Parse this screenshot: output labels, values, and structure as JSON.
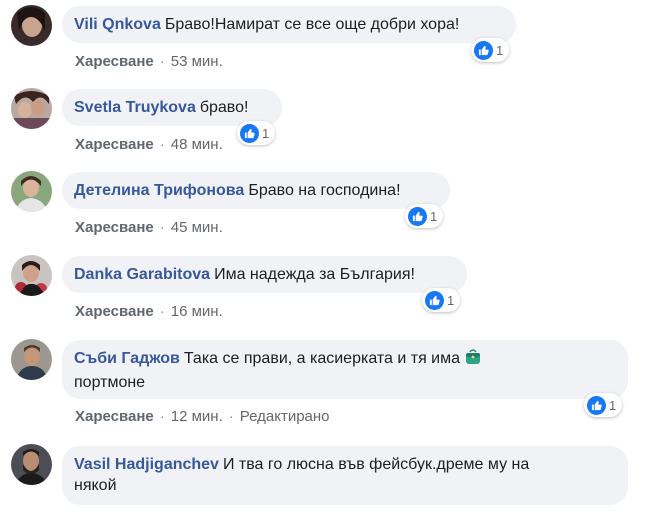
{
  "comments": [
    {
      "author": "Vili Qnkova",
      "text": "Браво!Намират се все още добри хора!",
      "like_label": "Харесване",
      "time": "53 мин.",
      "reactions": "1",
      "edited": ""
    },
    {
      "author": "Svetla Truykova",
      "text": "браво!",
      "like_label": "Харесване",
      "time": "48 мин.",
      "reactions": "1",
      "edited": ""
    },
    {
      "author": "Детелина Трифонова",
      "text": "Браво на господина!",
      "like_label": "Харесване",
      "time": "45 мин.",
      "reactions": "1",
      "edited": ""
    },
    {
      "author": "Danka Garabitova",
      "text": "Има надежда за България!",
      "like_label": "Харесване",
      "time": "16 мин.",
      "reactions": "1",
      "edited": ""
    },
    {
      "author": "Съби Гаджов",
      "text": "Така се прави, а касиерката и тя има",
      "text2": "портмоне",
      "like_label": "Харесване",
      "time": "12 мин.",
      "reactions": "1",
      "edited": "Редактирано"
    },
    {
      "author": "Vasil Hadjiganchev",
      "text": "И тва го люсна във фейсбук.дреме му на",
      "text2": "някой"
    }
  ],
  "icons": {
    "like": "thumbs-up-icon",
    "purse": "purse-emoji-icon"
  },
  "colors": {
    "author": "#385898",
    "bubble": "#f0f2f5",
    "like_blue": "#1877f2",
    "meta": "#65676b"
  }
}
